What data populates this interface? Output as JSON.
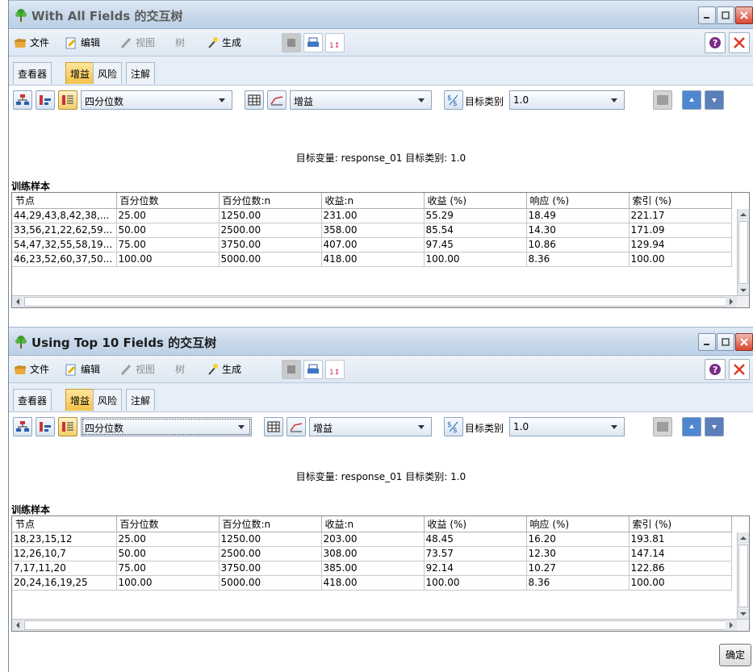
{
  "windows": [
    {
      "title": "With All Fields 的交互树",
      "menu": {
        "file": "文件",
        "edit": "编辑",
        "view": "视图",
        "tree": "树",
        "generate": "生成"
      },
      "tabs": [
        "查看器",
        "增益",
        "风险",
        "注解"
      ],
      "active_tab": 1,
      "toolbar": {
        "quantile_select": "四分位数",
        "measure_select": "增益",
        "target_category_label": "目标类别",
        "target_category_select": "1.0"
      },
      "subtitle": "目标变量: response_01   目标类别: 1.0",
      "section_label": "训练样本",
      "table": {
        "columns": [
          "节点",
          "百分位数",
          "百分位数:n",
          "收益:n",
          "收益 (%)",
          "响应 (%)",
          "索引 (%)"
        ],
        "rows": [
          [
            "44,29,43,8,42,38,...",
            "25.00",
            "1250.00",
            "231.00",
            "55.29",
            "18.49",
            "221.17"
          ],
          [
            "33,56,21,22,62,59...",
            "50.00",
            "2500.00",
            "358.00",
            "85.54",
            "14.30",
            "171.09"
          ],
          [
            "54,47,32,55,58,19...",
            "75.00",
            "3750.00",
            "407.00",
            "97.45",
            "10.86",
            "129.94"
          ],
          [
            "46,23,52,60,37,50...",
            "100.00",
            "5000.00",
            "418.00",
            "100.00",
            "8.36",
            "100.00"
          ]
        ]
      }
    },
    {
      "title": "Using Top 10 Fields 的交互树",
      "menu": {
        "file": "文件",
        "edit": "编辑",
        "view": "视图",
        "tree": "树",
        "generate": "生成"
      },
      "tabs": [
        "查看器",
        "增益",
        "风险",
        "注解"
      ],
      "active_tab": 1,
      "toolbar": {
        "quantile_select": "四分位数",
        "measure_select": "增益",
        "target_category_label": "目标类别",
        "target_category_select": "1.0"
      },
      "subtitle": "目标变量: response_01   目标类别: 1.0",
      "section_label": "训练样本",
      "table": {
        "columns": [
          "节点",
          "百分位数",
          "百分位数:n",
          "收益:n",
          "收益 (%)",
          "响应 (%)",
          "索引 (%)"
        ],
        "rows": [
          [
            "18,23,15,12",
            "25.00",
            "1250.00",
            "203.00",
            "48.45",
            "16.20",
            "193.81"
          ],
          [
            "12,26,10,7",
            "50.00",
            "2500.00",
            "308.00",
            "73.57",
            "12.30",
            "147.14"
          ],
          [
            "7,17,11,20",
            "75.00",
            "3750.00",
            "385.00",
            "92.14",
            "10.27",
            "122.86"
          ],
          [
            "20,24,16,19,25",
            "100.00",
            "5000.00",
            "418.00",
            "100.00",
            "8.36",
            "100.00"
          ]
        ]
      },
      "ok_button": "确定"
    }
  ],
  "icons": {
    "tree": "tree-icon",
    "file": "folder-icon",
    "edit": "edit-icon",
    "view": "brush-icon",
    "generate": "wand-icon",
    "print": "printer-icon",
    "sort": "sort-icon",
    "help": "help-icon",
    "close": "close-icon",
    "currency": "currency-icon"
  },
  "colors": {
    "active_tab": "#f5c24b",
    "close_button": "#d9452f",
    "help": "#7a2d86"
  }
}
